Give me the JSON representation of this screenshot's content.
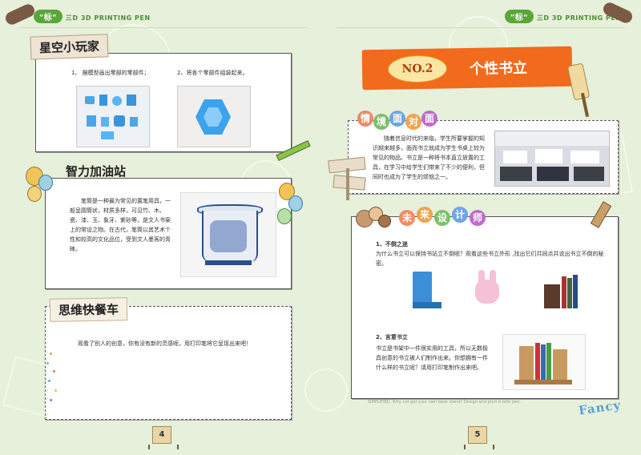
{
  "header": {
    "brand_pill": "\"标\"",
    "brand_text": "三D  3D PRINTING PEN",
    "brand_text_right": "三D  3D PRINTING PEN"
  },
  "left": {
    "section1": {
      "title": "星空小玩家",
      "step1": "1、 据模型画出零部的零部件；",
      "step2": "2、将各个零部件组装起来。"
    },
    "section2": {
      "title": "智力加油站",
      "text": "笔筒是一种最为常见的置笔用具，一般呈圆筒状，材质多样，可见竹、木、瓷、漆、玉、象牙、紫砂等，是文人书案上的常设之物。在古代，笔筒以其艺术个性和较高的文化品位，受到文人墨客的青睐。"
    },
    "section3": {
      "title": "思维快餐车",
      "text": "观看了别人的创意，你有没有新的灵感呢，用打印笔将它呈现出来吧！"
    },
    "page_number": "4"
  },
  "right": {
    "banner": {
      "no": "NO.2",
      "title": "个性书立"
    },
    "scenario": {
      "tags": [
        "情",
        "境",
        "面",
        "对",
        "面"
      ],
      "text": "随着信息时代的来临，学生所要掌握的知识越来越多，面而书立就成为学生书桌上较为常见的物品。书立是一种将书本直立放置的工具，在学习中给学生们带来了不少的便利，但同时也成为了学生的烦恼之一。"
    },
    "designer": {
      "tags": [
        "未",
        "来",
        "设",
        "计",
        "师"
      ],
      "q1_title": "1、不倒之迷",
      "q1_text": "为什么书立可以保持书站立不倒呢？观看这些书立外形 ,找出它们共同点并说出书立不倒的秘密。",
      "q2_title": "2、言意书立",
      "q2_text": "书立是书架中一件很实用的工具，所以无数极具创意的书立被人们制作出来。你想拥有一件什么样的书立呢？请用打印笔制作出来吧。",
      "footer_note": "SIMPLIFIED. Why not get your own book stand? Design and print it with pen."
    },
    "logo_text": "Fancy",
    "page_number": "5"
  },
  "colors": {
    "accent_orange": "#f26a1c",
    "brand_green": "#5aa63a",
    "page_bg": "#e6f0da"
  }
}
